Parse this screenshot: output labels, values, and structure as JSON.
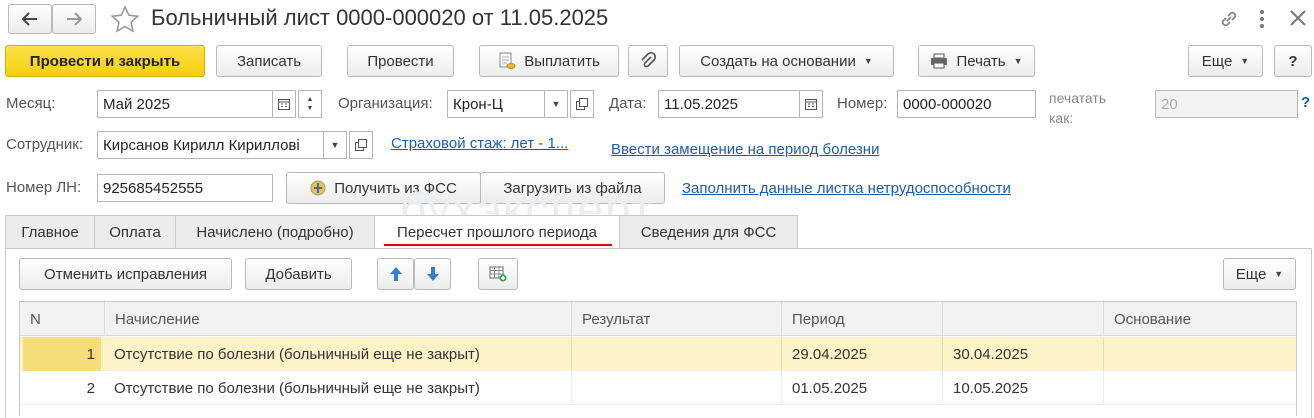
{
  "window": {
    "title": "Больничный лист 0000-000020 от 11.05.2025",
    "watermark": "бухэксперт"
  },
  "toolbar": {
    "post_and_close": "Провести и закрыть",
    "save": "Записать",
    "post": "Провести",
    "pay": "Выплатить",
    "create_based_on": "Создать на основании",
    "print": "Печать",
    "more": "Еще",
    "help": "?"
  },
  "form": {
    "month_label": "Месяц:",
    "month_value": "Май 2025",
    "org_label": "Организация:",
    "org_value": "Крон-Ц",
    "date_label": "Дата:",
    "date_value": "11.05.2025",
    "number_label": "Номер:",
    "number_value": "0000-000020",
    "print_as_label_1": "печатать",
    "print_as_label_2": "как:",
    "print_as_value": "20",
    "help_q": "?",
    "employee_label": "Сотрудник:",
    "employee_value": "Кирсанов Кирилл Кирилловi",
    "insurance_link": "Страховой стаж: лет - 1...",
    "replacement_link": "Ввести замещение на период болезни",
    "ln_label": "Номер ЛН:",
    "ln_value": "925685452555",
    "get_from_fss": "Получить из ФСС",
    "load_from_file": "Загрузить из файла",
    "fill_data_link": "Заполнить данные листка нетрудоспособности"
  },
  "tabs": [
    {
      "label": "Главное"
    },
    {
      "label": "Оплата"
    },
    {
      "label": "Начислено (подробно)"
    },
    {
      "label": "Пересчет прошлого периода"
    },
    {
      "label": "Сведения для ФСС"
    }
  ],
  "table_toolbar": {
    "cancel_corrections": "Отменить исправления",
    "add": "Добавить",
    "more": "Еще"
  },
  "table": {
    "columns": [
      "N",
      "Начисление",
      "Результат",
      "Период",
      "",
      "Основание"
    ],
    "rows": [
      {
        "n": "1",
        "accrual": "Отсутствие по болезни (больничный еще не закрыт)",
        "result": "",
        "period_from": "29.04.2025",
        "period_to": "30.04.2025",
        "basis": ""
      },
      {
        "n": "2",
        "accrual": "Отсутствие по болезни (больничный еще не закрыт)",
        "result": "",
        "period_from": "01.05.2025",
        "period_to": "10.05.2025",
        "basis": ""
      }
    ]
  },
  "colors": {
    "primary_button": "#f5cf0c",
    "link": "#1a5eb4",
    "selected_row": "#fdf3c9",
    "tab_underline": "#e00000"
  }
}
